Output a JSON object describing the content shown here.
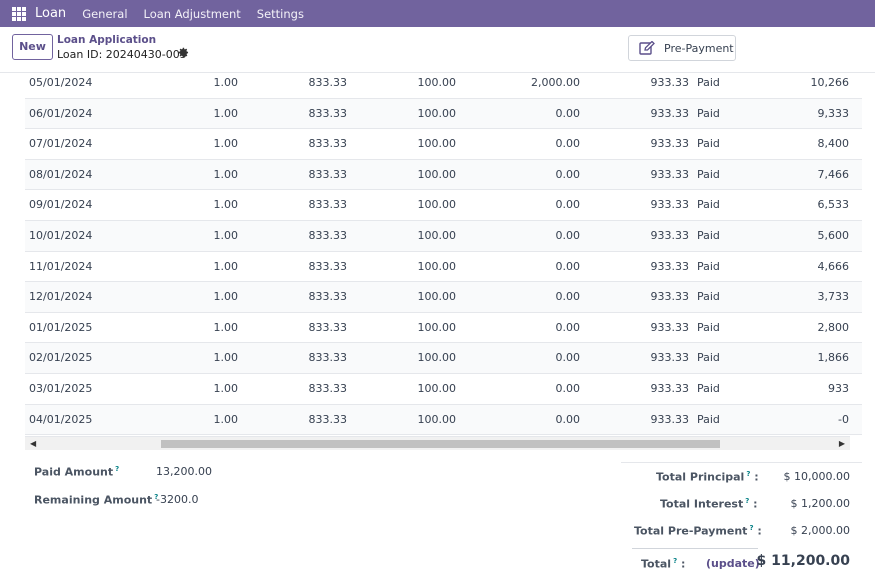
{
  "navbar": {
    "brand": "Loan",
    "menu": [
      "General",
      "Loan Adjustment",
      "Settings"
    ]
  },
  "control": {
    "new_label": "New",
    "breadcrumb": "Loan Application",
    "record_id": "Loan ID: 20240430-005",
    "prepayment_label": "Pre-Payment"
  },
  "rows": [
    {
      "date": "05/01/2024",
      "a": "1.00",
      "b": "833.33",
      "c": "100.00",
      "d": "2,000.00",
      "e": "933.33",
      "status": "Paid",
      "balance": "10,266"
    },
    {
      "date": "06/01/2024",
      "a": "1.00",
      "b": "833.33",
      "c": "100.00",
      "d": "0.00",
      "e": "933.33",
      "status": "Paid",
      "balance": "9,333"
    },
    {
      "date": "07/01/2024",
      "a": "1.00",
      "b": "833.33",
      "c": "100.00",
      "d": "0.00",
      "e": "933.33",
      "status": "Paid",
      "balance": "8,400"
    },
    {
      "date": "08/01/2024",
      "a": "1.00",
      "b": "833.33",
      "c": "100.00",
      "d": "0.00",
      "e": "933.33",
      "status": "Paid",
      "balance": "7,466"
    },
    {
      "date": "09/01/2024",
      "a": "1.00",
      "b": "833.33",
      "c": "100.00",
      "d": "0.00",
      "e": "933.33",
      "status": "Paid",
      "balance": "6,533"
    },
    {
      "date": "10/01/2024",
      "a": "1.00",
      "b": "833.33",
      "c": "100.00",
      "d": "0.00",
      "e": "933.33",
      "status": "Paid",
      "balance": "5,600"
    },
    {
      "date": "11/01/2024",
      "a": "1.00",
      "b": "833.33",
      "c": "100.00",
      "d": "0.00",
      "e": "933.33",
      "status": "Paid",
      "balance": "4,666"
    },
    {
      "date": "12/01/2024",
      "a": "1.00",
      "b": "833.33",
      "c": "100.00",
      "d": "0.00",
      "e": "933.33",
      "status": "Paid",
      "balance": "3,733"
    },
    {
      "date": "01/01/2025",
      "a": "1.00",
      "b": "833.33",
      "c": "100.00",
      "d": "0.00",
      "e": "933.33",
      "status": "Paid",
      "balance": "2,800"
    },
    {
      "date": "02/01/2025",
      "a": "1.00",
      "b": "833.33",
      "c": "100.00",
      "d": "0.00",
      "e": "933.33",
      "status": "Paid",
      "balance": "1,866"
    },
    {
      "date": "03/01/2025",
      "a": "1.00",
      "b": "833.33",
      "c": "100.00",
      "d": "0.00",
      "e": "933.33",
      "status": "Paid",
      "balance": "933"
    },
    {
      "date": "04/01/2025",
      "a": "1.00",
      "b": "833.33",
      "c": "100.00",
      "d": "0.00",
      "e": "933.33",
      "status": "Paid",
      "balance": "-0"
    }
  ],
  "summary": {
    "paid_label": "Paid Amount",
    "paid_value": "13,200.00",
    "remaining_label": "Remaining Amount",
    "remaining_value": "-3200.0",
    "tooltip_mark": "?"
  },
  "totals": {
    "principal_label": "Total Principal",
    "principal_value": "$ 10,000.00",
    "interest_label": "Total Interest",
    "interest_value": "$ 1,200.00",
    "prepayment_label": "Total Pre-Payment",
    "prepayment_value": "$ 2,000.00",
    "total_label": "Total",
    "update_label": "(update)",
    "total_value": "$ 11,200.00",
    "colon": ":"
  },
  "colors": {
    "navbar": "#71639e",
    "accent": "#5b4f8a",
    "tooltip": "#017e84"
  }
}
